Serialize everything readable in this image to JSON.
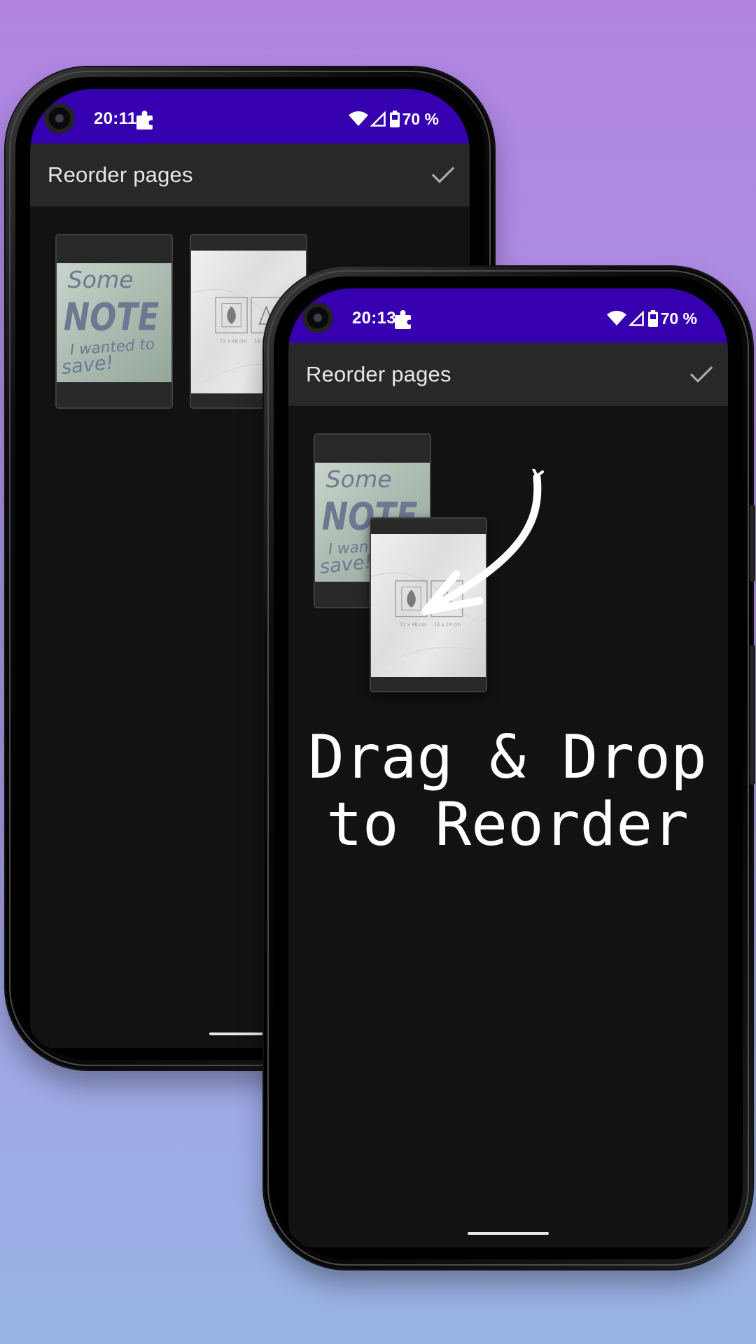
{
  "phones": [
    {
      "status_bar": {
        "time": "20:11",
        "battery": "70 %"
      },
      "app_bar": {
        "title": "Reorder pages",
        "confirm_icon": "check-icon"
      },
      "pages": [
        {
          "kind": "note",
          "note_text": [
            "Some",
            "NOTE",
            "I wanted to",
            "save!"
          ]
        },
        {
          "kind": "marble",
          "caption_a": "72 x 48 cm",
          "caption_b": "18 x 24 cm"
        }
      ]
    },
    {
      "status_bar": {
        "time": "20:13",
        "battery": "70 %"
      },
      "app_bar": {
        "title": "Reorder pages",
        "confirm_icon": "check-icon"
      },
      "pages": [
        {
          "kind": "note",
          "note_text": [
            "Some",
            "NOTE",
            "I wanted to",
            "save!"
          ]
        },
        {
          "kind": "marble",
          "caption_a": "72 x 48 cm",
          "caption_b": "18 x 24 cm"
        }
      ]
    }
  ],
  "overlay": {
    "line1": "Drag & Drop",
    "line2": "to Reorder",
    "arrow_icon": "curved-arrow-icon"
  },
  "colors": {
    "status_bar": "#3600b0",
    "app_bar": "#282828",
    "screen_bg": "#121212",
    "bg_top": "#b184e2",
    "bg_bottom": "#98b4e5"
  }
}
